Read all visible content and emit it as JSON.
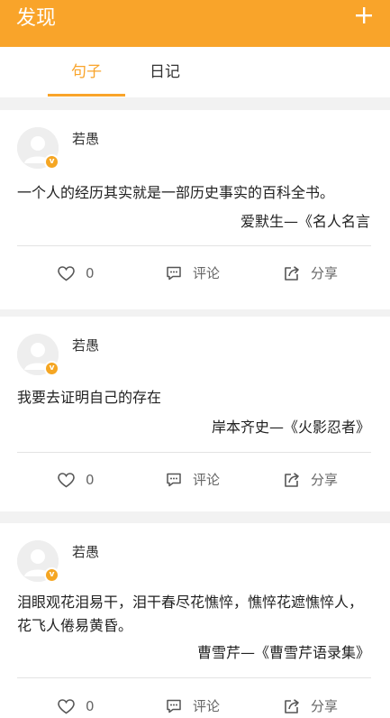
{
  "header": {
    "title": "发现",
    "add_icon": "plus-icon",
    "background_color": "#f9a42a"
  },
  "tabs": [
    {
      "label": "句子",
      "active": true
    },
    {
      "label": "日记",
      "active": false
    }
  ],
  "accent_color": "#f9a42a",
  "posts": [
    {
      "user": "若愚",
      "verified_badge": "v",
      "content": "一个人的经历其实就是一部历史事实的百科全书。",
      "source": "爱默生—《名人名言",
      "likes": "0",
      "comment_label": "评论",
      "share_label": "分享"
    },
    {
      "user": "若愚",
      "verified_badge": "v",
      "content": "我要去证明自己的存在",
      "source": "岸本齐史—《火影忍者》",
      "likes": "0",
      "comment_label": "评论",
      "share_label": "分享"
    },
    {
      "user": "若愚",
      "verified_badge": "v",
      "content": "泪眼观花泪易干，泪干春尽花憔悴，憔悴花遮憔悴人，花飞人倦易黄昏。",
      "source": "曹雪芹—《曹雪芹语录集》",
      "likes": "0",
      "comment_label": "评论",
      "share_label": "分享"
    }
  ]
}
